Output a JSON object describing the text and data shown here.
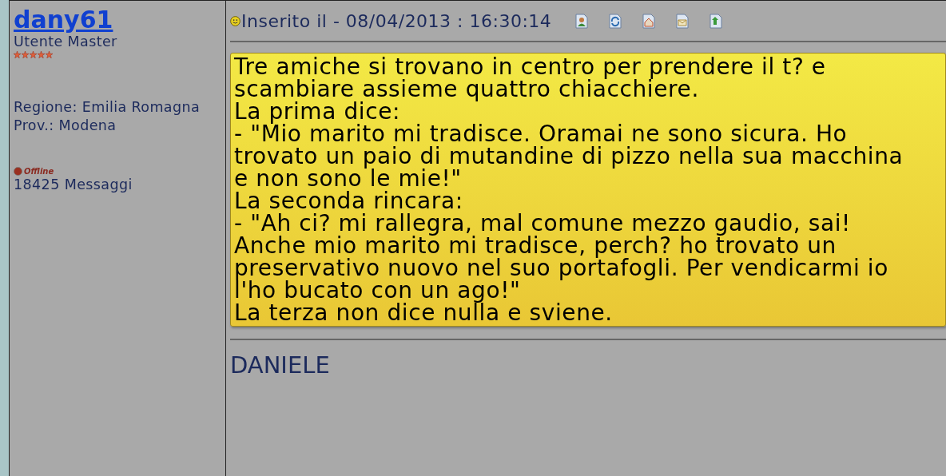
{
  "author": {
    "name": "dany61",
    "rank": "Utente Master",
    "stars": 5,
    "region": "Regione: Emilia Romagna",
    "province": "Prov.: Modena",
    "status": "Offline",
    "online": false,
    "posts": "18425 Messaggi"
  },
  "post": {
    "posted": "Inserito il - 08/04/2013 : 16:30:14",
    "lines": [
      "Tre amiche si trovano in centro per prendere il t? e",
      "scambiare assieme quattro chiacchiere.",
      "La prima dice:",
      "- \"Mio marito mi tradisce. Oramai ne sono sicura. Ho",
      "trovato un paio di mutandine di pizzo nella sua macchina",
      "e non sono le mie!\"",
      "La seconda rincara:",
      "- \"Ah ci? mi rallegra, mal comune mezzo gaudio, sai!",
      "Anche mio marito mi tradisce, perch? ho trovato un",
      "preservativo nuovo nel suo portafogli. Per vendicarmi io",
      "l'ho bucato con un ago!\"",
      "La terza non dice nulla e sviene."
    ],
    "signature": "DANIELE"
  }
}
